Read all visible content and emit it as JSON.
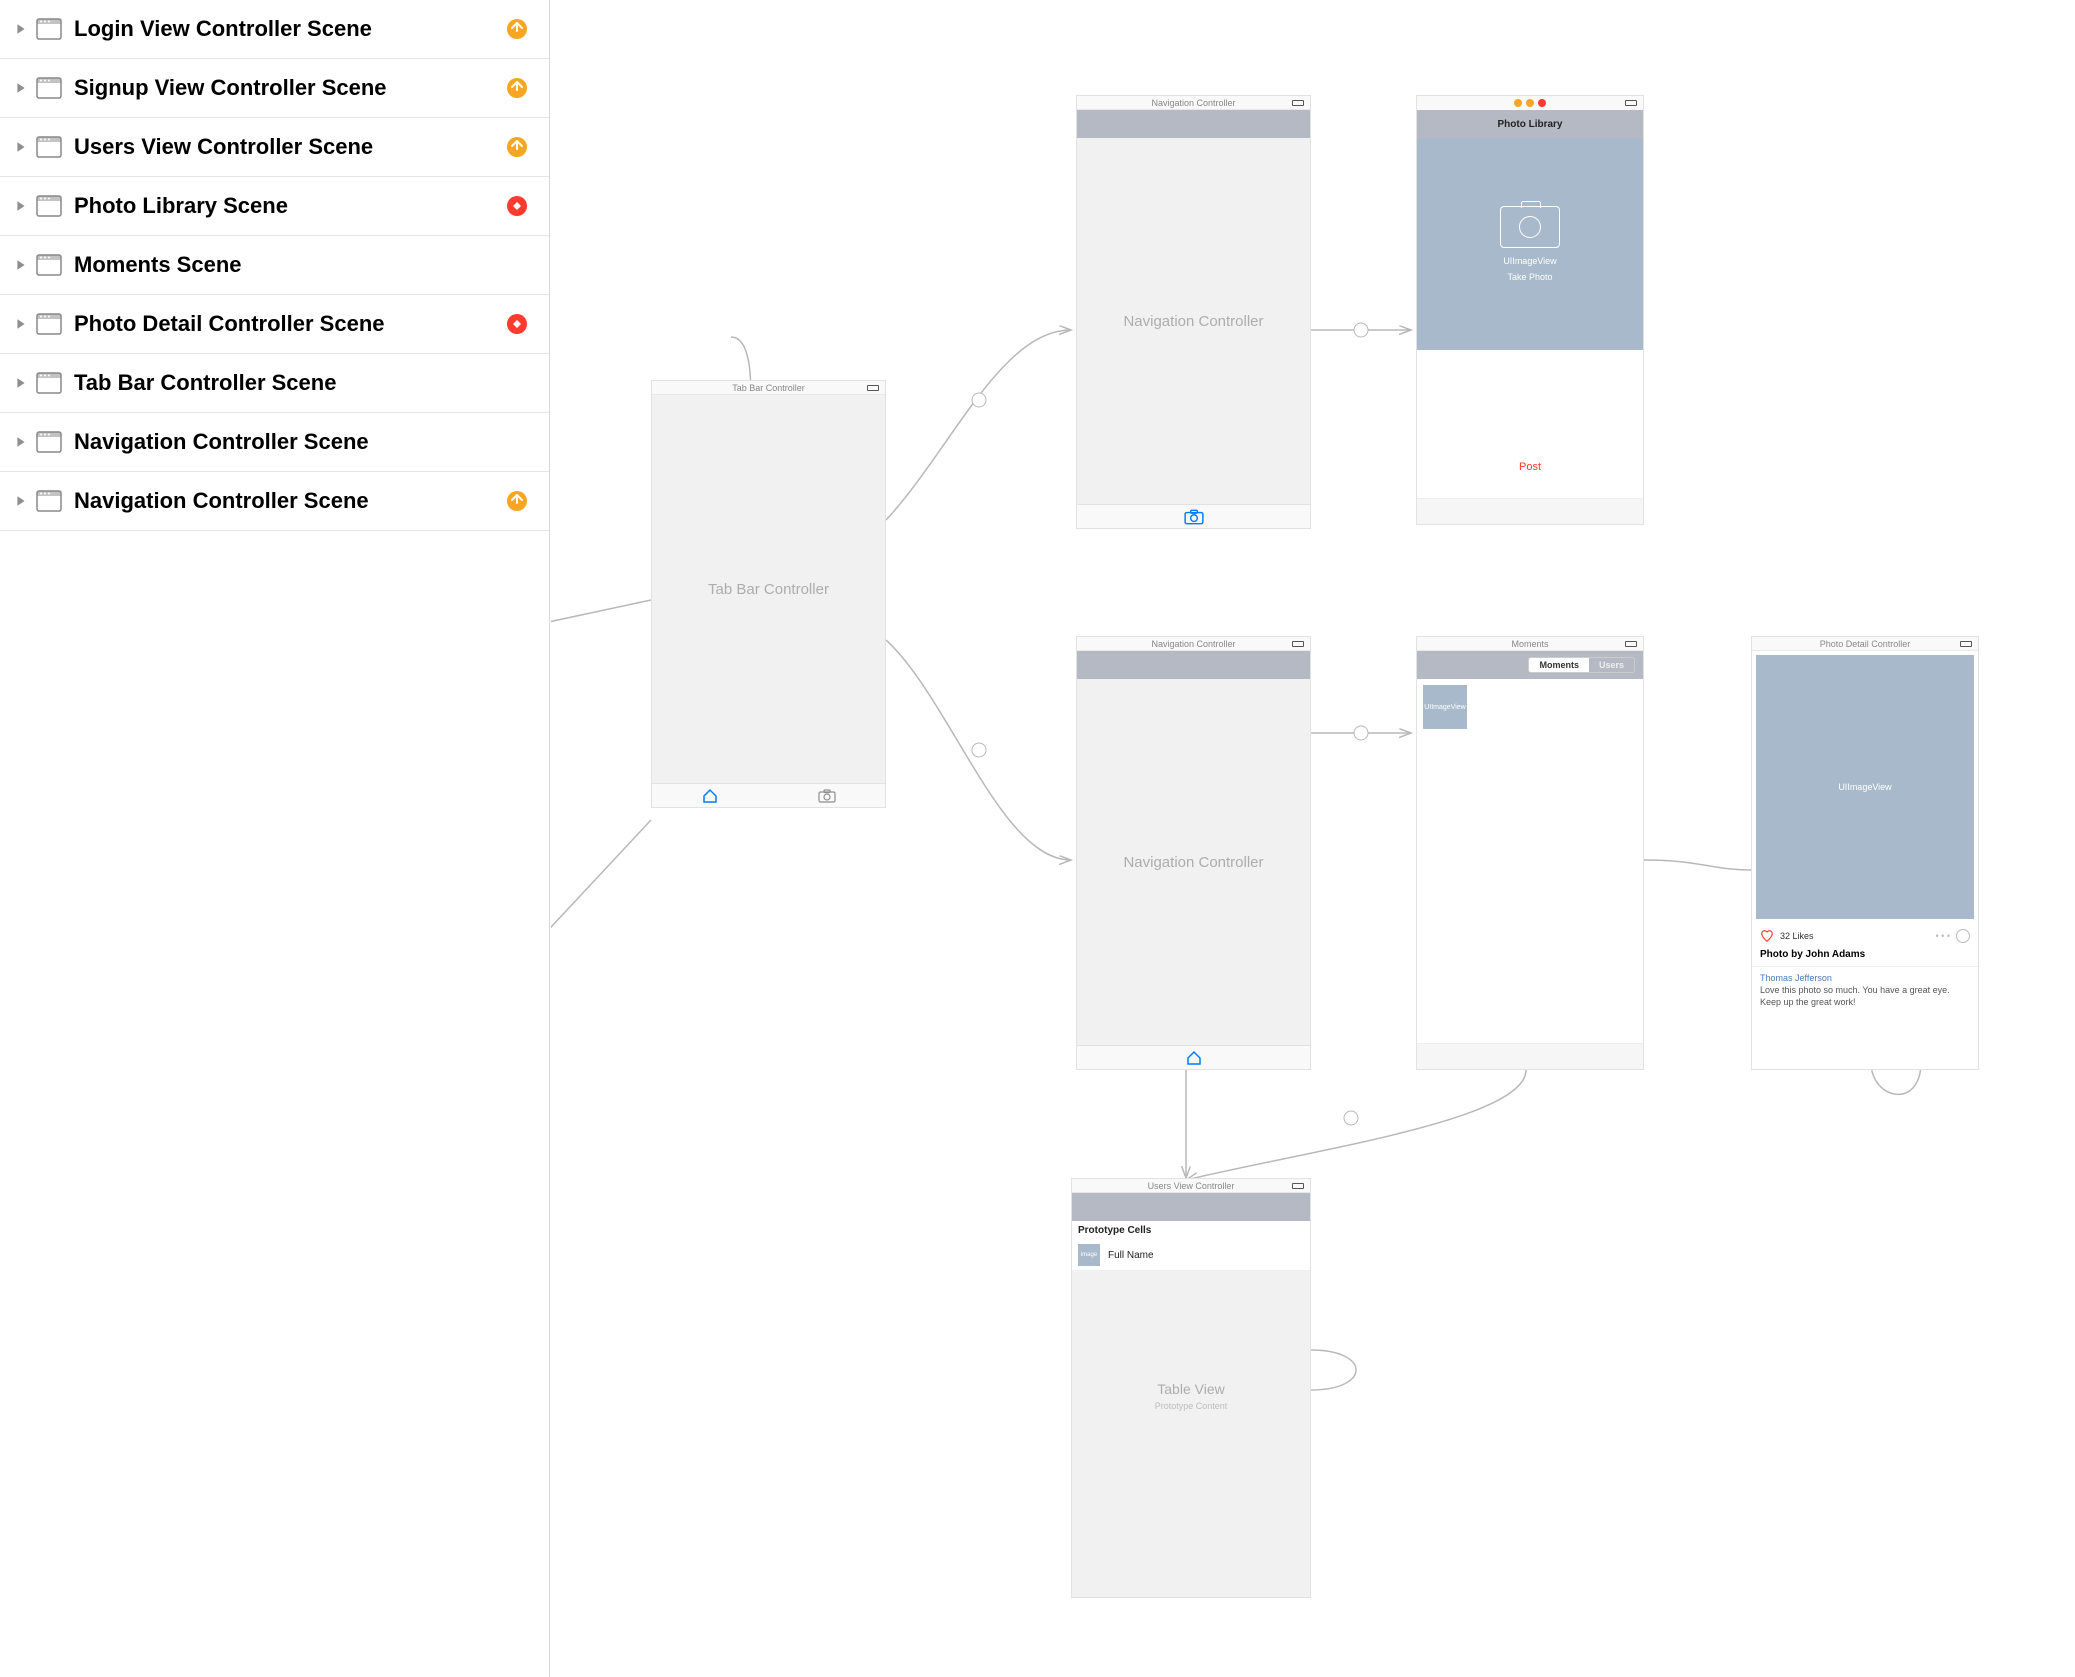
{
  "sidebar": {
    "items": [
      {
        "label": "Login View Controller Scene",
        "status": "yellow"
      },
      {
        "label": "Signup View Controller Scene",
        "status": "yellow"
      },
      {
        "label": "Users View Controller Scene",
        "status": "yellow"
      },
      {
        "label": "Photo Library Scene",
        "status": "red"
      },
      {
        "label": "Moments Scene",
        "status": null
      },
      {
        "label": "Photo Detail Controller Scene",
        "status": "red"
      },
      {
        "label": "Tab Bar Controller Scene",
        "status": null
      },
      {
        "label": "Navigation Controller Scene",
        "status": null
      },
      {
        "label": "Navigation Controller Scene",
        "status": "yellow"
      }
    ]
  },
  "canvas": {
    "tabbar": {
      "title": "Tab Bar Controller",
      "body": "Tab Bar Controller"
    },
    "nav1": {
      "title": "Navigation Controller",
      "body": "Navigation Controller"
    },
    "nav2": {
      "title": "Navigation Controller",
      "body": "Navigation Controller"
    },
    "photolib": {
      "navtitle": "Photo Library",
      "img_label": "UIImageView",
      "take_photo": "Take Photo",
      "post": "Post"
    },
    "moments": {
      "title": "Moments",
      "seg_active": "Moments",
      "seg_inactive": "Users",
      "thumb_label": "UIImageView"
    },
    "photodetail": {
      "title": "Photo Detail Controller",
      "img_label": "UIImageView",
      "likes": "32 Likes",
      "author": "Photo by John Adams",
      "commenter": "Thomas Jefferson",
      "comment": "Love this photo so much. You have a great eye. Keep up the great work!"
    },
    "users": {
      "title": "Users View Controller",
      "proto_header": "Prototype Cells",
      "cell_thumb": "image",
      "cell_name": "Full Name",
      "table_label": "Table View",
      "table_sublabel": "Prototype Content"
    }
  }
}
